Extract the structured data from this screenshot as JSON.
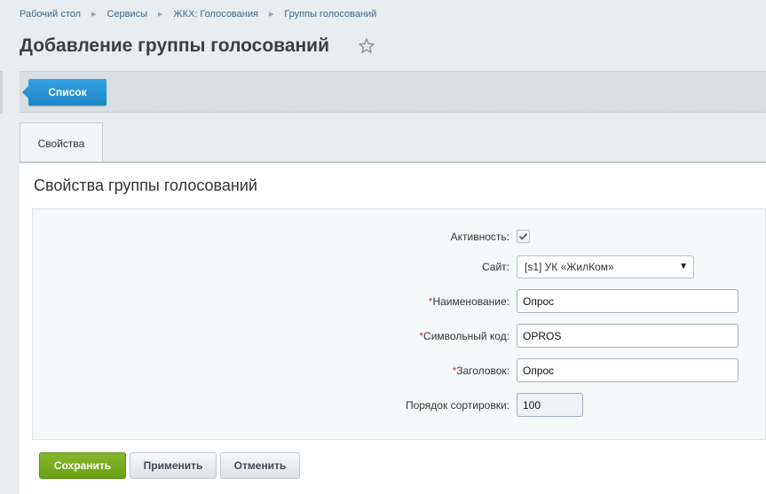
{
  "breadcrumb": {
    "items": [
      "Рабочий стол",
      "Сервисы",
      "ЖКХ: Голосования",
      "Группы голосований"
    ]
  },
  "page": {
    "title": "Добавление группы голосований"
  },
  "toolbar": {
    "list_label": "Список"
  },
  "tabs": [
    {
      "label": "Свойства"
    }
  ],
  "section": {
    "title": "Свойства группы голосований"
  },
  "form": {
    "active": {
      "label": "Активность:",
      "checked": true
    },
    "site": {
      "label": "Сайт:",
      "value": "[s1] УК «ЖилКом»"
    },
    "name": {
      "label": "Наименование:",
      "value": "Опрос",
      "required": "*"
    },
    "code": {
      "label": "Символьный код:",
      "value": "OPROS",
      "required": "*"
    },
    "heading": {
      "label": "Заголовок:",
      "value": "Опрос",
      "required": "*"
    },
    "sort": {
      "label": "Порядок сортировки:",
      "value": "100"
    }
  },
  "buttons": {
    "save": "Сохранить",
    "apply": "Применить",
    "cancel": "Отменить"
  },
  "colors": {
    "accent_blue": "#2a95d6",
    "save_green": "#7ab01f",
    "required_red": "#d33333"
  }
}
